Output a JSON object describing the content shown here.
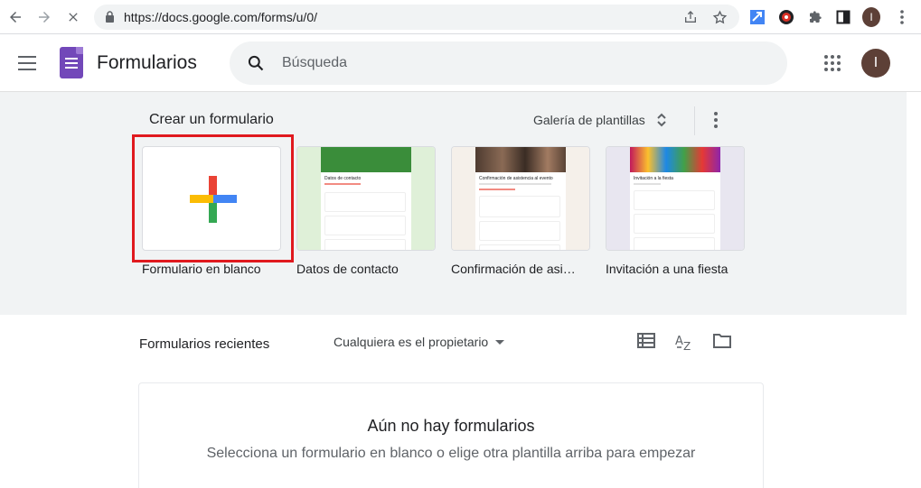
{
  "browser": {
    "url": "https://docs.google.com/forms/u/0/",
    "profile_initial": "I"
  },
  "app": {
    "title": "Formularios",
    "search_placeholder": "Búsqueda",
    "avatar_initial": "I",
    "accent_color": "#7248b9"
  },
  "gallery": {
    "heading": "Crear un formulario",
    "gallery_button": "Galería de plantillas",
    "templates": [
      {
        "label": "Formulario en blanco"
      },
      {
        "label": "Datos de contacto",
        "card_title": "Datos de contacto"
      },
      {
        "label": "Confirmación de asi…",
        "card_title": "Confirmación de asistencia al evento"
      },
      {
        "label": "Invitación a una fiesta",
        "card_title": "Invitación a la fiesta"
      }
    ]
  },
  "recent": {
    "heading": "Formularios recientes",
    "owner_filter": "Cualquiera es el propietario",
    "empty_title": "Aún no hay formularios",
    "empty_subtitle": "Selecciona un formulario en blanco o elige otra plantilla arriba para empezar"
  }
}
